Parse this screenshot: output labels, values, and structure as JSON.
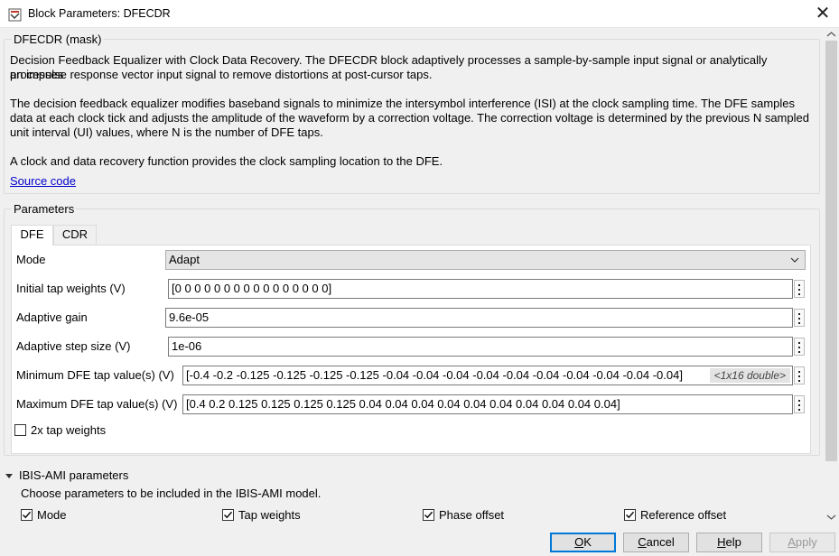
{
  "window": {
    "title": "Block Parameters: DFECDR",
    "close_glyph": "✕"
  },
  "mask": {
    "legend": "DFECDR (mask)",
    "paragraph1_line1": "Decision Feedback Equalizer with Clock Data Recovery. The DFECDR block adaptively processes a sample-by-sample input signal or analytically processes",
    "paragraph1_line2": "an impulse response vector input signal to remove distortions at post-cursor taps.",
    "paragraph2_line1": "The decision feedback equalizer modifies baseband signals to minimize the intersymbol interference (ISI) at the clock sampling time. The DFE samples",
    "paragraph2_line2": "data at each clock tick and adjusts the amplitude of the waveform by a correction voltage. The correction voltage is determined by the previous N sampled",
    "paragraph2_line3": "unit interval (UI) values, where N is the number of DFE taps.",
    "paragraph3": "A clock and data recovery function provides the clock sampling location to the DFE.",
    "source_link": "Source code"
  },
  "parameters": {
    "legend": "Parameters",
    "tabs": [
      {
        "label": "DFE",
        "active": true
      },
      {
        "label": "CDR",
        "active": false
      }
    ],
    "mode": {
      "label": "Mode",
      "value": "Adapt"
    },
    "initial_tap_weights": {
      "label": "Initial tap weights (V)",
      "value": "[0 0 0 0 0 0 0 0 0 0 0 0 0 0 0 0]"
    },
    "adaptive_gain": {
      "label": "Adaptive gain",
      "value": "9.6e-05"
    },
    "adaptive_step_size": {
      "label": "Adaptive step size (V)",
      "value": "1e-06"
    },
    "min_tap": {
      "label": "Minimum DFE tap value(s) (V)",
      "value": "[-0.4 -0.2 -0.125 -0.125 -0.125 -0.125 -0.04 -0.04 -0.04 -0.04 -0.04 -0.04 -0.04 -0.04 -0.04 -0.04]",
      "hint": "<1x16 double>"
    },
    "max_tap": {
      "label": "Maximum DFE tap value(s) (V)",
      "value": "[0.4 0.2 0.125 0.125 0.125 0.125 0.04 0.04 0.04 0.04 0.04 0.04 0.04 0.04 0.04 0.04]"
    },
    "two_x_tap_weights": {
      "label": "2x tap weights",
      "checked": false
    }
  },
  "ibis": {
    "title": "IBIS-AMI parameters",
    "description": "Choose parameters to be included in the IBIS-AMI model.",
    "checks": [
      {
        "label": "Mode",
        "checked": true
      },
      {
        "label": "Tap weights",
        "checked": true
      },
      {
        "label": "Phase offset",
        "checked": true
      },
      {
        "label": "Reference offset",
        "checked": true
      }
    ]
  },
  "buttons": {
    "ok": "OK",
    "ok_mnemonic": "O",
    "ok_rest": "K",
    "cancel": "Cancel",
    "cancel_mnemonic": "C",
    "cancel_rest": "ancel",
    "help": "Help",
    "help_mnemonic": "H",
    "help_rest": "elp",
    "apply": "Apply",
    "apply_mnemonic": "A",
    "apply_rest": "pply"
  },
  "icons": {
    "app": "block-parameters-icon",
    "close": "close-icon",
    "dropdown": "chevron-down-icon",
    "collapse": "triangle-down-icon"
  }
}
